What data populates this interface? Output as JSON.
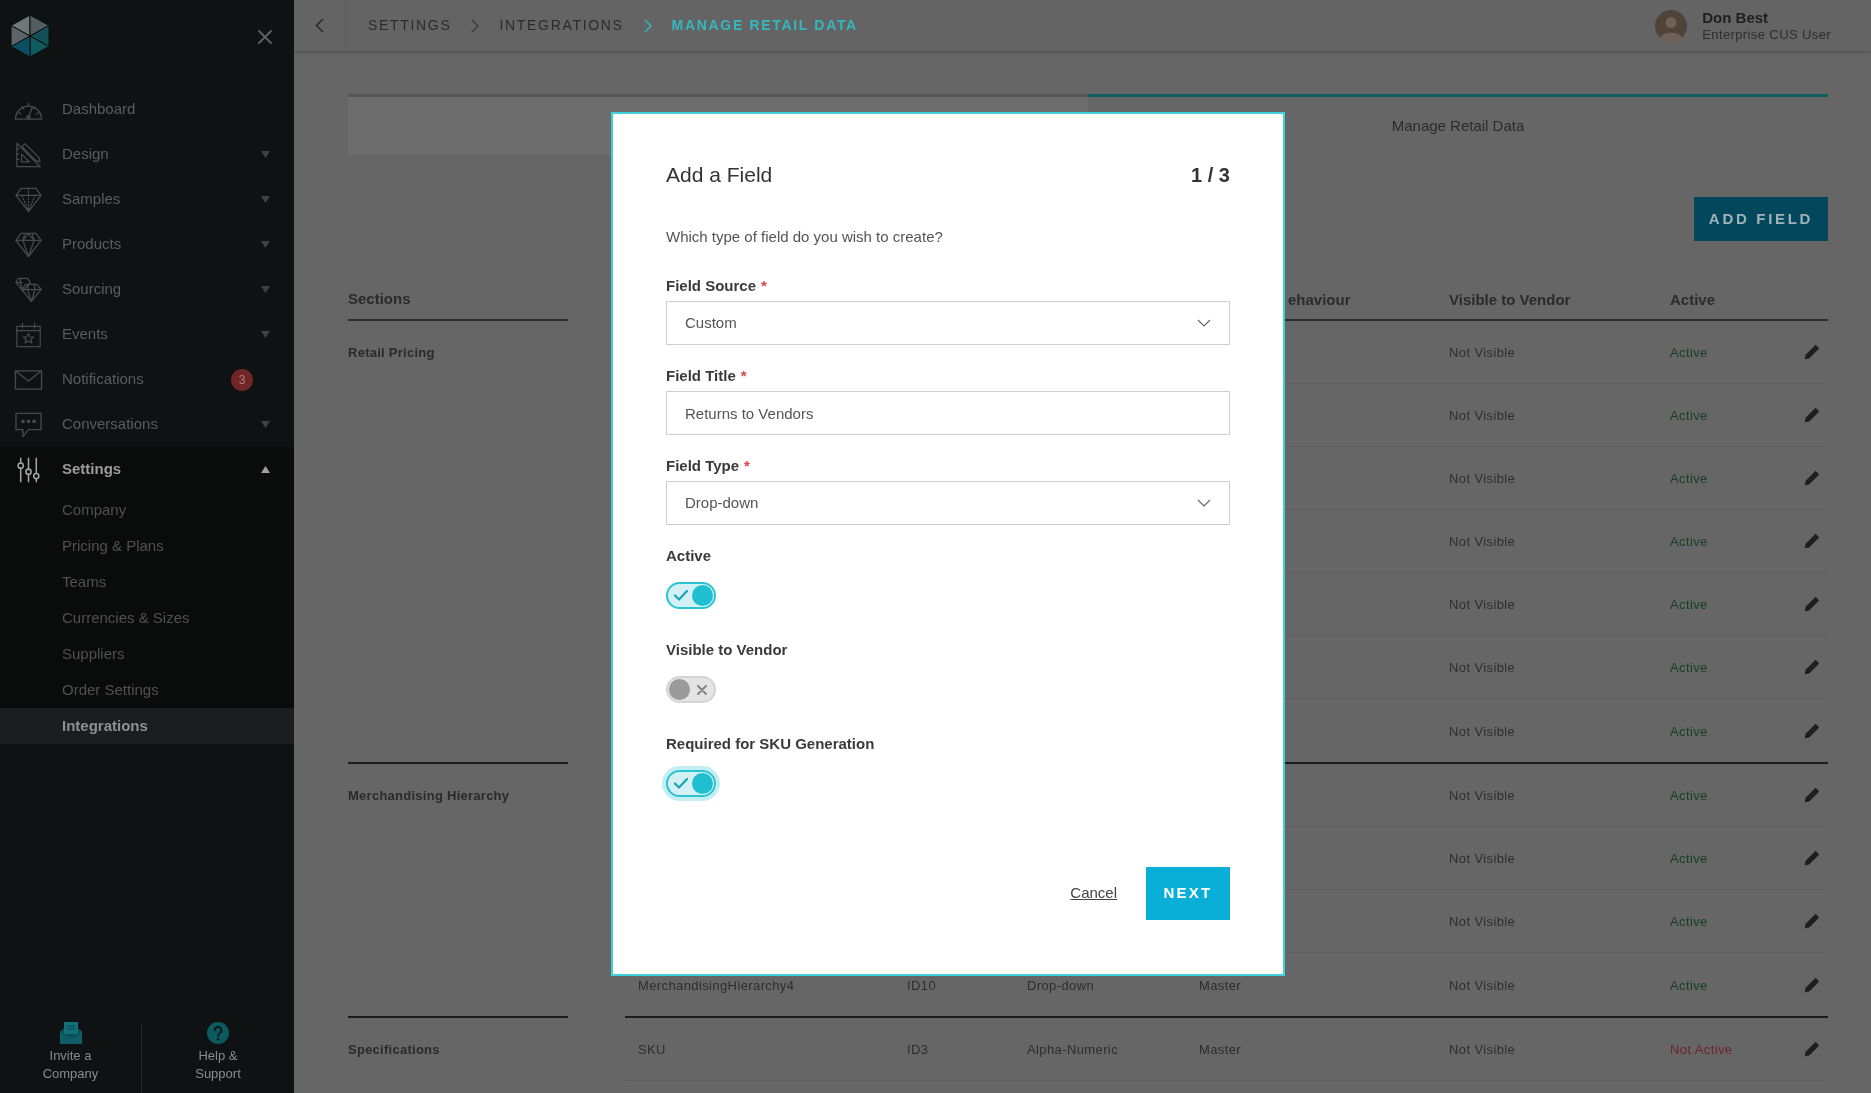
{
  "sidebar": {
    "items": [
      {
        "label": "Dashboard",
        "selected": false
      },
      {
        "label": "Design",
        "selected": false,
        "expanded": false
      },
      {
        "label": "Samples",
        "selected": false,
        "expanded": false
      },
      {
        "label": "Products",
        "selected": false,
        "expanded": false
      },
      {
        "label": "Sourcing",
        "selected": false,
        "expanded": false
      },
      {
        "label": "Events",
        "selected": false,
        "expanded": false
      },
      {
        "label": "Notifications",
        "selected": false,
        "badge": "3"
      },
      {
        "label": "Conversations",
        "selected": false,
        "expanded": false
      },
      {
        "label": "Settings",
        "selected": true,
        "expanded": true,
        "children": [
          {
            "label": "Company",
            "selected": false
          },
          {
            "label": "Pricing & Plans",
            "selected": false
          },
          {
            "label": "Teams",
            "selected": false
          },
          {
            "label": "Currencies & Sizes",
            "selected": false
          },
          {
            "label": "Suppliers",
            "selected": false
          },
          {
            "label": "Order Settings",
            "selected": false
          },
          {
            "label": "Integrations",
            "selected": true
          }
        ]
      }
    ],
    "footer": [
      {
        "label": "Invite a Company"
      },
      {
        "label": "Help & Support"
      }
    ]
  },
  "header": {
    "breadcrumb": [
      {
        "label": "SETTINGS",
        "current": false
      },
      {
        "label": "INTEGRATIONS",
        "current": false
      },
      {
        "label": "MANAGE RETAIL DATA",
        "current": true
      }
    ],
    "user": {
      "name": "Don Best",
      "role": "Enterprise CUS User"
    }
  },
  "tabs": [
    {
      "selected": false
    },
    {
      "label": "Manage Retail Data",
      "selected": true
    }
  ],
  "add_button": "ADD FIELD",
  "table": {
    "columns": [
      {
        "label": "Sections"
      },
      {
        "label": "ehaviour"
      },
      {
        "label": "Visible to Vendor"
      },
      {
        "label": "Active"
      }
    ],
    "sections": [
      {
        "name": "Retail Pricing",
        "rows": [
          {
            "visible": "Not Visible",
            "status": "Active",
            "color": "#153f22"
          },
          {
            "visible": "Not Visible",
            "status": "Active",
            "color": "#153f22"
          },
          {
            "visible": "Not Visible",
            "status": "Active",
            "color": "#153f22"
          },
          {
            "visible": "Not Visible",
            "status": "Active",
            "color": "#153f22"
          },
          {
            "visible": "Not Visible",
            "status": "Active",
            "color": "#153f22"
          },
          {
            "visible": "Not Visible",
            "status": "Active",
            "color": "#153f22"
          },
          {
            "visible": "Not Visible",
            "status": "Active",
            "color": "#153f22"
          }
        ]
      },
      {
        "name": "Merchandising Hierarchy",
        "rows": [
          {
            "visible": "Not Visible",
            "status": "Active",
            "color": "#153f22"
          },
          {
            "visible": "Not Visible",
            "status": "Active",
            "color": "#153f22"
          },
          {
            "visible": "Not Visible",
            "status": "Active",
            "color": "#153f22"
          },
          {
            "name": "MerchandisingHierarchy4",
            "id": "ID10",
            "type": "Drop-down",
            "behaviour": "Master",
            "visible": "Not Visible",
            "status": "Active",
            "color": "#153f22"
          }
        ]
      },
      {
        "name": "Specifications",
        "rows": [
          {
            "name": "SKU",
            "id": "ID3",
            "type": "Alpha-Numeric",
            "behaviour": "Master",
            "visible": "Not Visible",
            "status": "Not Active",
            "color": "#6e2232"
          }
        ]
      }
    ]
  },
  "modal": {
    "title": "Add a Field",
    "step": "1 / 3",
    "question": "Which type of field do you wish to create?",
    "fields": [
      {
        "kind": "select",
        "label": "Field Source",
        "marker": "*",
        "value": "Custom"
      },
      {
        "kind": "text",
        "label": "Field Title",
        "marker": "*",
        "value": "Returns to Vendors"
      },
      {
        "kind": "select",
        "label": "Field Type",
        "marker": "*",
        "value": "Drop-down"
      },
      {
        "kind": "toggle",
        "label": "Active",
        "on": true,
        "focused": false
      },
      {
        "kind": "toggle",
        "label": "Visible to Vendor",
        "on": false,
        "focused": false
      },
      {
        "kind": "toggle",
        "label": "Required for SKU Generation",
        "on": true,
        "focused": true
      }
    ],
    "cancel": "Cancel",
    "next": "NEXT"
  }
}
